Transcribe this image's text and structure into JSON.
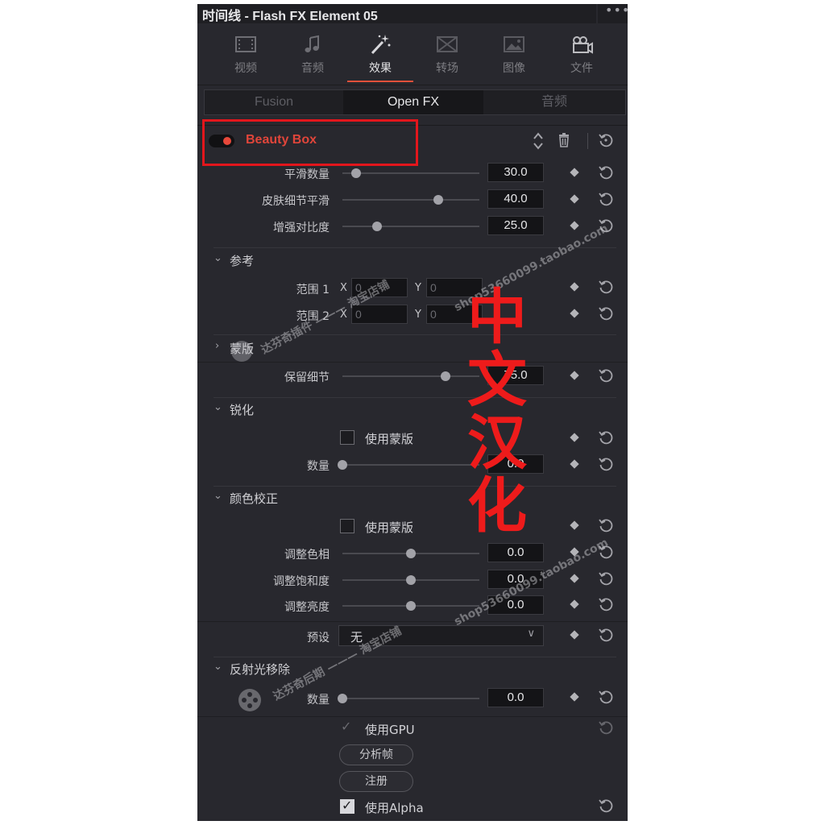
{
  "window": {
    "title": "时间线 - Flash FX Element 05",
    "menu_glyph": "•••"
  },
  "top_tabs": [
    {
      "label": "视频",
      "icon": "film-icon"
    },
    {
      "label": "音频",
      "icon": "music-note-icon"
    },
    {
      "label": "效果",
      "icon": "magic-wand-icon",
      "active": true
    },
    {
      "label": "转场",
      "icon": "transition-icon"
    },
    {
      "label": "图像",
      "icon": "image-icon"
    },
    {
      "label": "文件",
      "icon": "file-camera-icon"
    }
  ],
  "sub_tabs": {
    "fusion": "Fusion",
    "openfx": "Open FX",
    "audio": "音频",
    "active": "Open FX"
  },
  "effect": {
    "name": "Beauty Box",
    "enabled": true
  },
  "params": {
    "smooth_amount": {
      "label": "平滑数量",
      "value": "30.0",
      "level": 0.1
    },
    "skin_detail": {
      "label": "皮肤细节平滑",
      "value": "40.0",
      "level": 0.7
    },
    "contrast": {
      "label": "增强对比度",
      "value": "25.0",
      "level": 0.25
    }
  },
  "reference": {
    "title": "参考",
    "range1": {
      "label": "范围 1",
      "x_label": "X",
      "x": "0",
      "y_label": "Y",
      "y": "0"
    },
    "range2": {
      "label": "范围 2",
      "x_label": "X",
      "x": "0",
      "y_label": "Y",
      "y": "0"
    }
  },
  "mask": {
    "title": "蒙版",
    "keep_detail": {
      "label": "保留细节",
      "value": "75.0",
      "level": 0.75
    }
  },
  "sharpen": {
    "title": "锐化",
    "use_mask_label": "使用蒙版",
    "amount": {
      "label": "数量",
      "value": "0.0",
      "level": 0
    }
  },
  "color_correction": {
    "title": "颜色校正",
    "use_mask_label": "使用蒙版",
    "hue": {
      "label": "调整色相",
      "value": "0.0",
      "level": 0.5
    },
    "saturation": {
      "label": "调整饱和度",
      "value": "0.0",
      "level": 0.5
    },
    "brightness": {
      "label": "调整亮度",
      "value": "0.0",
      "level": 0.5
    },
    "preset": {
      "label": "预设",
      "value": "无"
    }
  },
  "reflection": {
    "title": "反射光移除",
    "amount": {
      "label": "数量",
      "value": "0.0",
      "level": 0
    }
  },
  "options": {
    "use_gpu": "使用GPU",
    "analyze": "分析帧",
    "register": "注册",
    "use_alpha": "使用Alpha"
  },
  "watermark": {
    "big": [
      "中",
      "文",
      "汉",
      "化"
    ],
    "store1": "达芬奇插件 ——— 淘宝店铺",
    "url1": "shop53660099.taobao.com",
    "store2": "达芬奇后期 ——— 淘宝店铺",
    "url2": "shop53660099.taobao.com"
  },
  "colors": {
    "accent": "#e0503a",
    "panel_bg": "#28282e",
    "highlight_red": "#e2161c"
  }
}
